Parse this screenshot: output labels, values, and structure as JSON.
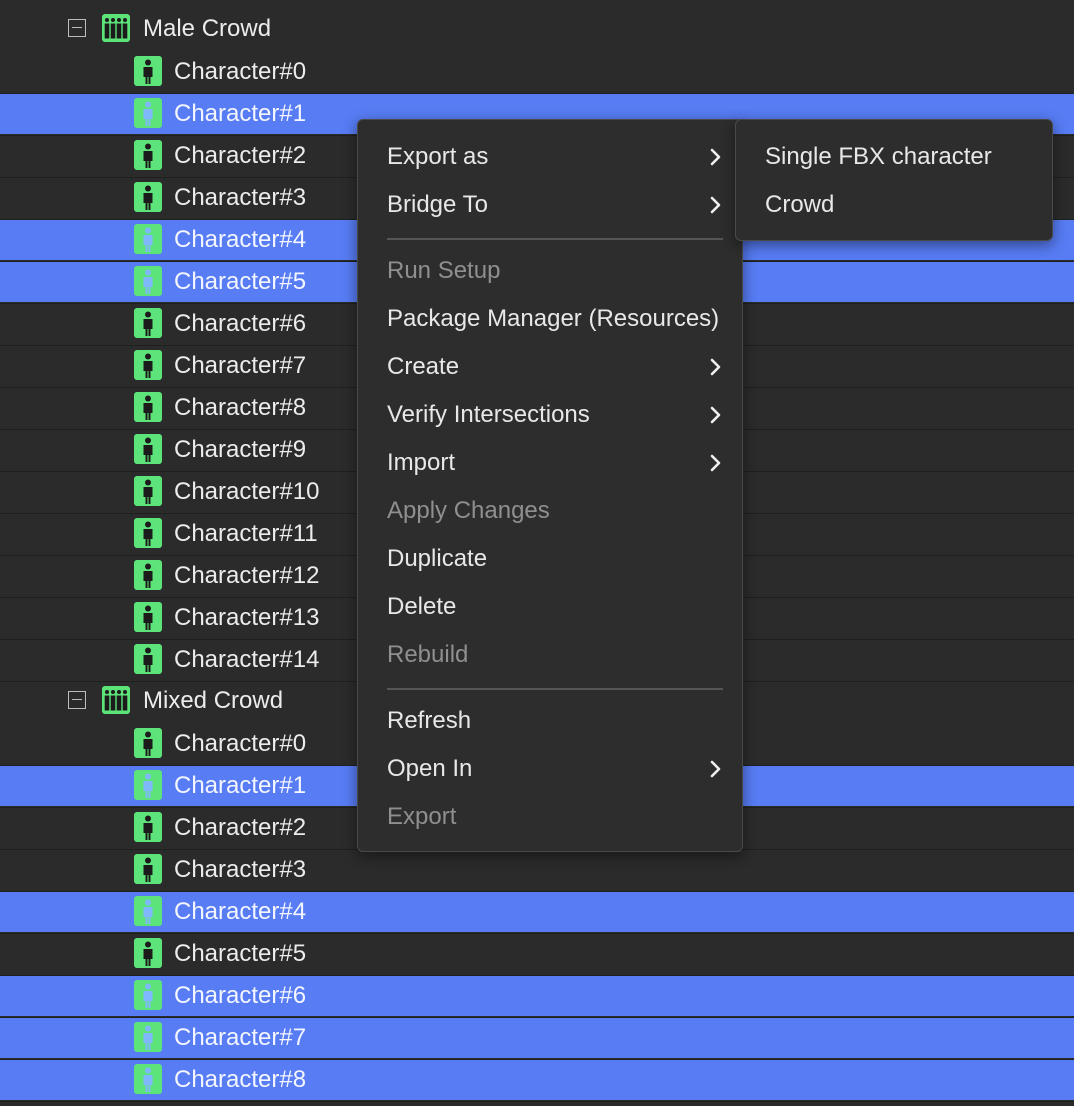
{
  "colors": {
    "background": "#2b2b2b",
    "selection": "#577cf4",
    "icon_green": "#5ce47a",
    "menu_bg": "#2d2d2d",
    "disabled_text": "#8f8f8f"
  },
  "tree": {
    "groups": [
      {
        "name": "Male Crowd",
        "icon": "crowd-icon",
        "expanded": true,
        "children": [
          {
            "label": "Character#0",
            "selected": false
          },
          {
            "label": "Character#1",
            "selected": true
          },
          {
            "label": "Character#2",
            "selected": false
          },
          {
            "label": "Character#3",
            "selected": false
          },
          {
            "label": "Character#4",
            "selected": true
          },
          {
            "label": "Character#5",
            "selected": true
          },
          {
            "label": "Character#6",
            "selected": false
          },
          {
            "label": "Character#7",
            "selected": false
          },
          {
            "label": "Character#8",
            "selected": false
          },
          {
            "label": "Character#9",
            "selected": false
          },
          {
            "label": "Character#10",
            "selected": false
          },
          {
            "label": "Character#11",
            "selected": false
          },
          {
            "label": "Character#12",
            "selected": false
          },
          {
            "label": "Character#13",
            "selected": false
          },
          {
            "label": "Character#14",
            "selected": false
          }
        ]
      },
      {
        "name": "Mixed Crowd",
        "icon": "crowd-icon",
        "expanded": true,
        "children": [
          {
            "label": "Character#0",
            "selected": false
          },
          {
            "label": "Character#1",
            "selected": true
          },
          {
            "label": "Character#2",
            "selected": false
          },
          {
            "label": "Character#3",
            "selected": false
          },
          {
            "label": "Character#4",
            "selected": true
          },
          {
            "label": "Character#5",
            "selected": false
          },
          {
            "label": "Character#6",
            "selected": true
          },
          {
            "label": "Character#7",
            "selected": true
          },
          {
            "label": "Character#8",
            "selected": true
          }
        ]
      }
    ]
  },
  "context_menu": {
    "sections": [
      [
        {
          "label": "Export as",
          "submenu": true,
          "disabled": false
        },
        {
          "label": "Bridge To",
          "submenu": true,
          "disabled": false
        }
      ],
      [
        {
          "label": "Run Setup",
          "submenu": false,
          "disabled": true
        },
        {
          "label": "Package Manager (Resources)",
          "submenu": false,
          "disabled": false
        },
        {
          "label": "Create",
          "submenu": true,
          "disabled": false
        },
        {
          "label": "Verify Intersections",
          "submenu": true,
          "disabled": false
        },
        {
          "label": "Import",
          "submenu": true,
          "disabled": false
        },
        {
          "label": "Apply Changes",
          "submenu": false,
          "disabled": true
        },
        {
          "label": "Duplicate",
          "submenu": false,
          "disabled": false
        },
        {
          "label": "Delete",
          "submenu": false,
          "disabled": false
        },
        {
          "label": "Rebuild",
          "submenu": false,
          "disabled": true
        }
      ],
      [
        {
          "label": "Refresh",
          "submenu": false,
          "disabled": false
        },
        {
          "label": "Open In",
          "submenu": true,
          "disabled": false
        },
        {
          "label": "Export",
          "submenu": false,
          "disabled": true
        }
      ]
    ]
  },
  "submenu": {
    "parent": "Export as",
    "items": [
      {
        "label": "Single FBX character"
      },
      {
        "label": "Crowd"
      }
    ]
  }
}
